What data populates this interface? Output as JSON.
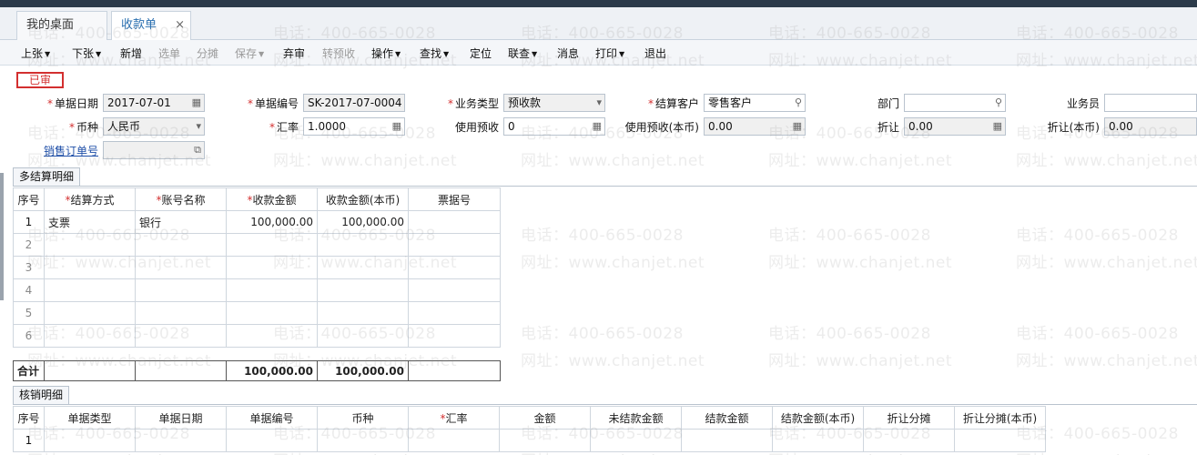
{
  "tabs": [
    {
      "label": "我的桌面"
    },
    {
      "label": "收款单",
      "close": "×"
    }
  ],
  "toolbar": [
    {
      "label": "上张",
      "menu": true,
      "enabled": true
    },
    {
      "label": "下张",
      "menu": true,
      "enabled": true
    },
    {
      "label": "新增",
      "menu": false,
      "enabled": true
    },
    {
      "label": "选单",
      "menu": false,
      "enabled": false
    },
    {
      "label": "分摊",
      "menu": false,
      "enabled": false
    },
    {
      "label": "保存",
      "menu": true,
      "enabled": false
    },
    {
      "label": "弃审",
      "menu": false,
      "enabled": true
    },
    {
      "label": "转预收",
      "menu": false,
      "enabled": false
    },
    {
      "label": "操作",
      "menu": true,
      "enabled": true
    },
    {
      "label": "查找",
      "menu": true,
      "enabled": true
    },
    {
      "label": "定位",
      "menu": false,
      "enabled": true
    },
    {
      "label": "联查",
      "menu": true,
      "enabled": true
    },
    {
      "label": "消息",
      "menu": false,
      "enabled": true
    },
    {
      "label": "打印",
      "menu": true,
      "enabled": true
    },
    {
      "label": "退出",
      "menu": false,
      "enabled": true
    }
  ],
  "status": "已审",
  "form": {
    "doc_date": {
      "label": "单据日期",
      "value": "2017-07-01"
    },
    "doc_no": {
      "label": "单据编号",
      "value": "SK-2017-07-0004"
    },
    "biz_type": {
      "label": "业务类型",
      "value": "预收款"
    },
    "customer": {
      "label": "结算客户",
      "value": "零售客户"
    },
    "dept": {
      "label": "部门",
      "value": ""
    },
    "salesman": {
      "label": "业务员",
      "value": ""
    },
    "currency": {
      "label": "币种",
      "value": "人民币"
    },
    "rate": {
      "label": "汇率",
      "value": "1.0000"
    },
    "use_prepay": {
      "label": "使用预收",
      "value": "0"
    },
    "use_prepay_local": {
      "label": "使用预收(本币)",
      "value": "0.00"
    },
    "discount": {
      "label": "折让",
      "value": "0.00"
    },
    "discount_local": {
      "label": "折让(本币)",
      "value": "0.00"
    },
    "sales_order": {
      "label": "销售订单号",
      "value": ""
    }
  },
  "multi": {
    "tab": "多结算明细",
    "headers": [
      "序号",
      "结算方式",
      "账号名称",
      "收款金额",
      "收款金额(本币)",
      "票据号"
    ],
    "rows": [
      [
        "1",
        "支票",
        "银行",
        "100,000.00",
        "100,000.00",
        ""
      ],
      [
        "2",
        "",
        "",
        "",
        "",
        ""
      ],
      [
        "3",
        "",
        "",
        "",
        "",
        ""
      ],
      [
        "4",
        "",
        "",
        "",
        "",
        ""
      ],
      [
        "5",
        "",
        "",
        "",
        "",
        ""
      ],
      [
        "6",
        "",
        "",
        "",
        "",
        ""
      ]
    ],
    "total_label": "合计",
    "total_amount": "100,000.00",
    "total_amount_local": "100,000.00"
  },
  "verify": {
    "tab": "核销明细",
    "headers": [
      "序号",
      "单据类型",
      "单据日期",
      "单据编号",
      "币种",
      "汇率",
      "金额",
      "未结款金额",
      "结款金额",
      "结款金额(本币)",
      "折让分摊",
      "折让分摊(本币)"
    ],
    "rows": [
      [
        "1",
        "",
        "",
        "",
        "",
        "",
        "",
        "",
        "",
        "",
        "",
        ""
      ]
    ]
  },
  "watermark": {
    "line1": "电话：400-665-0028",
    "line2": "网址：www.chanjet.net"
  }
}
